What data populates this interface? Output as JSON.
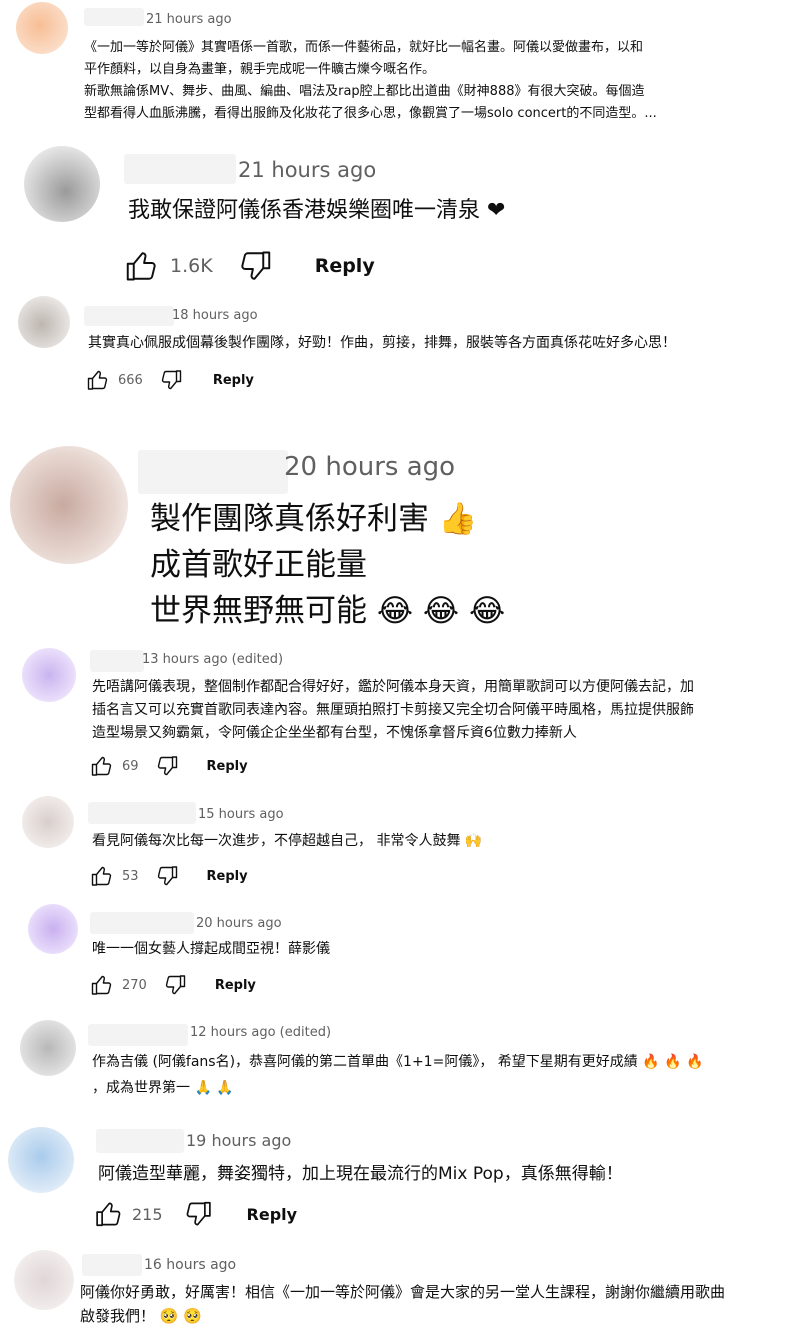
{
  "comments": [
    {
      "time": "21 hours ago",
      "lines": [
        "《一加一等於阿儀》其實唔係一首歌，而係一件藝術品，就好比一幅名畫。阿儀以愛做畫布，以和",
        "平作顏料，以自身為畫筆，親手完成呢一件曠古爍今嘅名作。",
        "新歌無論係MV、舞步、曲風、編曲、唱法及rap腔上都比出道曲《財神888》有很大突破。每個造",
        "型都看得人血脈沸騰，看得出服飾及化妝花了很多心思，像觀賞了一場solo concert的不同造型。..."
      ],
      "likes": "",
      "reply": ""
    },
    {
      "time": "21 hours ago",
      "lines": [
        "我敢保證阿儀係香港娛樂圈唯一清泉 ❤"
      ],
      "likes": "1.6K",
      "reply": "Reply"
    },
    {
      "time": "18 hours ago",
      "lines": [
        "其實真心佩服成個幕後製作團隊，好勁！作曲，剪接，排舞，服裝等各方面真係花咗好多心思！"
      ],
      "likes": "666",
      "reply": "Reply"
    },
    {
      "time": "20 hours ago",
      "lines": [
        "製作團隊真係好利害 👍",
        "成首歌好正能量",
        "世界無野無可能 😂 😂 😂"
      ],
      "likes": "",
      "reply": ""
    },
    {
      "time": "13 hours ago (edited)",
      "lines": [
        "先唔講阿儀表現，整個制作都配合得好好，鑑於阿儀本身天資，用簡單歌詞可以方便阿儀去記，加",
        "插名言又可以充實首歌同表達內容。無厘頭拍照打卡剪接又完全切合阿儀平時風格，馬拉提供服飾",
        "造型場景又夠霸氣，令阿儀企企坐坐都有台型，不愧係拿督斥資6位數力捧新人"
      ],
      "likes": "69",
      "reply": "Reply"
    },
    {
      "time": "15 hours ago",
      "lines": [
        "看見阿儀每次比每一次進步，不停超越自己， 非常令人鼓舞 🙌"
      ],
      "likes": "53",
      "reply": "Reply"
    },
    {
      "time": "20 hours ago",
      "lines": [
        "唯一一個女藝人撐起成間亞視！薛影儀"
      ],
      "likes": "270",
      "reply": "Reply"
    },
    {
      "time": "12 hours ago (edited)",
      "lines": [
        "作為吉儀 (阿儀fans名)，恭喜阿儀的第二首單曲《1+1=阿儀》， 希望下星期有更好成績 🔥 🔥 🔥",
        "，成為世界第一 🙏 🙏"
      ],
      "likes": "",
      "reply": ""
    },
    {
      "time": "19 hours ago",
      "lines": [
        "阿儀造型華麗，舞姿獨特，加上現在最流行的Mix Pop，真係無得輸！"
      ],
      "likes": "215",
      "reply": "Reply"
    },
    {
      "time": "16 hours ago",
      "lines": [
        "阿儀你好勇敢，好厲害！相信《一加一等於阿儀》會是大家的另一堂人生課程，謝謝你繼續用歌曲",
        "啟發我們！ 🥺 🥺"
      ],
      "likes": "",
      "reply": ""
    }
  ],
  "icons": {
    "like": "thumbs-up-icon",
    "dislike": "thumbs-down-icon"
  },
  "colors": {
    "avatar_orange": "#f6c39e",
    "avatar_purple": "#d5c4ee",
    "avatar_blue": "#c6ddf1",
    "avatar_gray": "#d4d4d4"
  }
}
